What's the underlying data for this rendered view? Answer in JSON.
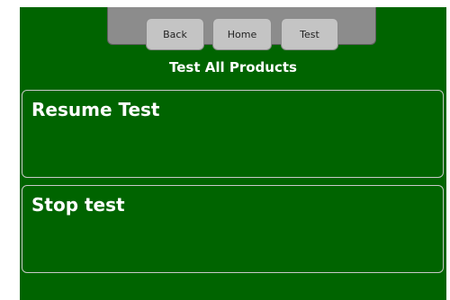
{
  "nav": {
    "back_label": "Back",
    "home_label": "Home",
    "test_label": "Test"
  },
  "page": {
    "title": "Test All Products"
  },
  "actions": [
    {
      "label": "Resume Test"
    },
    {
      "label": "Stop test"
    }
  ],
  "colors": {
    "background": "#006400",
    "nav_bar": "#8c8c8c",
    "nav_button": "#c4c4c4",
    "box_border": "#c8c8c8",
    "text": "#ffffff"
  }
}
